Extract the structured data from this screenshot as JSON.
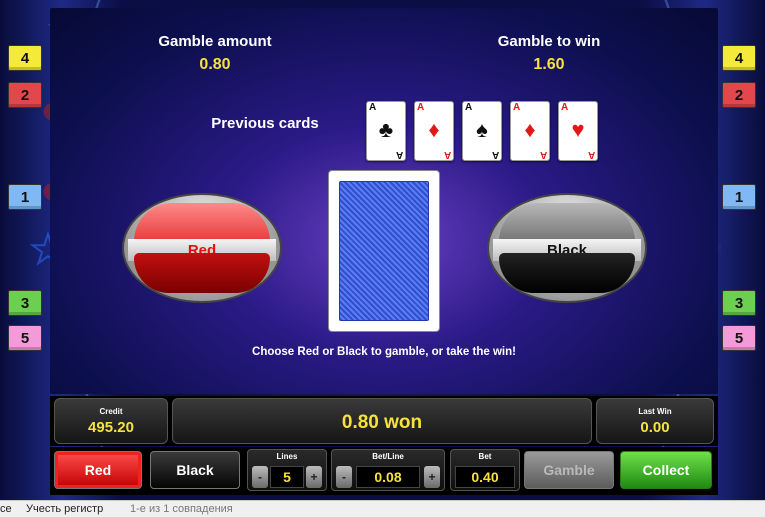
{
  "gamble": {
    "amount_label": "Gamble amount",
    "amount_value": "0.80",
    "to_win_label": "Gamble to win",
    "to_win_value": "1.60",
    "previous_cards_label": "Previous cards",
    "previous_cards": [
      {
        "rank": "A",
        "suit": "♣",
        "color": "black"
      },
      {
        "rank": "A",
        "suit": "♦",
        "color": "red"
      },
      {
        "rank": "A",
        "suit": "♠",
        "color": "black"
      },
      {
        "rank": "A",
        "suit": "♦",
        "color": "red"
      },
      {
        "rank": "A",
        "suit": "♥",
        "color": "red"
      }
    ],
    "red_label": "Red",
    "black_label": "Black",
    "hint": "Choose Red or Black to gamble, or take the win!"
  },
  "lines_left": [
    "4",
    "2",
    "1",
    "3",
    "5"
  ],
  "lines_right": [
    "4",
    "2",
    "1",
    "3",
    "5"
  ],
  "info": {
    "credit_label": "Credit",
    "credit_value": "495.20",
    "won_text": "0.80 won",
    "last_win_label": "Last Win",
    "last_win_value": "0.00"
  },
  "controls": {
    "red_label": "Red",
    "black_label": "Black",
    "lines_label": "Lines",
    "lines_value": "5",
    "bet_line_label": "Bet/Line",
    "bet_line_value": "0.08",
    "bet_label": "Bet",
    "bet_value": "0.40",
    "minus": "-",
    "plus": "+",
    "gamble_label": "Gamble",
    "collect_label": "Collect"
  },
  "find_bar": {
    "left_fragment": "се",
    "match_case": "Учесть регистр",
    "matches": "1-е из 1 совпадения"
  },
  "colors": {
    "accent_yellow": "#f6e23b",
    "red_button": "#c00000",
    "collect_green": "#1e8a12"
  }
}
